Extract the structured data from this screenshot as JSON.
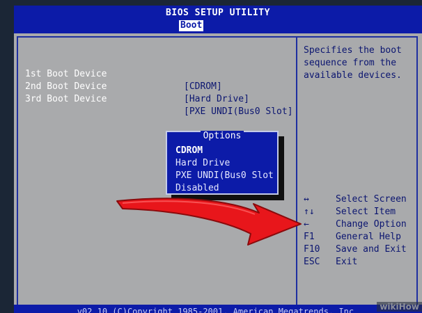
{
  "header": {
    "title": "BIOS SETUP UTILITY",
    "active_tab": "Boot"
  },
  "boot_devices": [
    {
      "label": "1st Boot Device",
      "value": "[CDROM]"
    },
    {
      "label": "2nd Boot Device",
      "value": "[Hard Drive]"
    },
    {
      "label": "3rd Boot Device",
      "value": "[PXE UNDI(Bus0 Slot]"
    }
  ],
  "help_text": "Specifies the boot\nsequence from the\navailable devices.",
  "keys": [
    {
      "key": "↔",
      "desc": "Select Screen"
    },
    {
      "key": "↑↓",
      "desc": "Select Item"
    },
    {
      "key": "←",
      "desc": "Change Option"
    },
    {
      "key": "F1",
      "desc": "General Help"
    },
    {
      "key": "F10",
      "desc": "Save and Exit"
    },
    {
      "key": "ESC",
      "desc": "Exit"
    }
  ],
  "options_popup": {
    "title": "Options",
    "items": [
      "CDROM",
      "Hard Drive",
      "PXE UNDI(Bus0 Slot",
      "Disabled"
    ],
    "selected": "CDROM"
  },
  "footer": "v02.10 (C)Copyright 1985-2001, American Megatrends, Inc.",
  "watermark": "wikiHow",
  "colors": {
    "header_blue": "#0c1ba8",
    "panel_gray": "#a9aaac",
    "label_white": "#ffffff",
    "value_navy": "#0b1570",
    "arrow_red": "#e8161b"
  }
}
